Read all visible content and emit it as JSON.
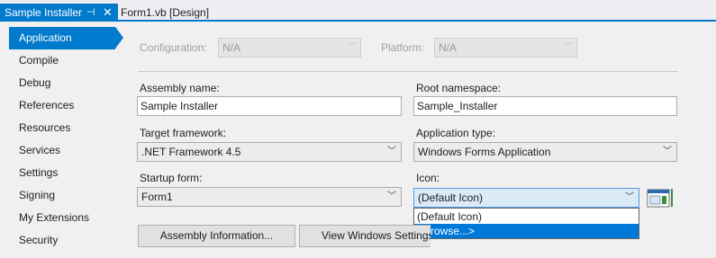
{
  "tabs": {
    "active": "Sample Installer",
    "pin": "⊣",
    "close": "✕",
    "inactive": "Form1.vb [Design]"
  },
  "nav": {
    "items": [
      "Application",
      "Compile",
      "Debug",
      "References",
      "Resources",
      "Services",
      "Settings",
      "Signing",
      "My Extensions",
      "Security"
    ],
    "selected": "Application"
  },
  "config": {
    "configuration_label": "Configuration:",
    "configuration_value": "N/A",
    "platform_label": "Platform:",
    "platform_value": "N/A"
  },
  "form": {
    "assembly_name_label": "Assembly name:",
    "assembly_name_value": "Sample Installer",
    "root_namespace_label": "Root namespace:",
    "root_namespace_value": "Sample_Installer",
    "target_framework_label": "Target framework:",
    "target_framework_value": ".NET Framework 4.5",
    "application_type_label": "Application type:",
    "application_type_value": "Windows Forms Application",
    "startup_form_label": "Startup form:",
    "startup_form_value": "Form1",
    "icon_label": "Icon:",
    "icon_value": "(Default Icon)"
  },
  "icon_dropdown": {
    "options": [
      "(Default Icon)",
      "<Browse...>"
    ],
    "highlighted": "<Browse...>"
  },
  "buttons": {
    "assembly_info": "Assembly Information...",
    "view_windows_settings": "View Windows Settings"
  },
  "colors": {
    "accent": "#007acc",
    "highlight": "#0078d7"
  }
}
